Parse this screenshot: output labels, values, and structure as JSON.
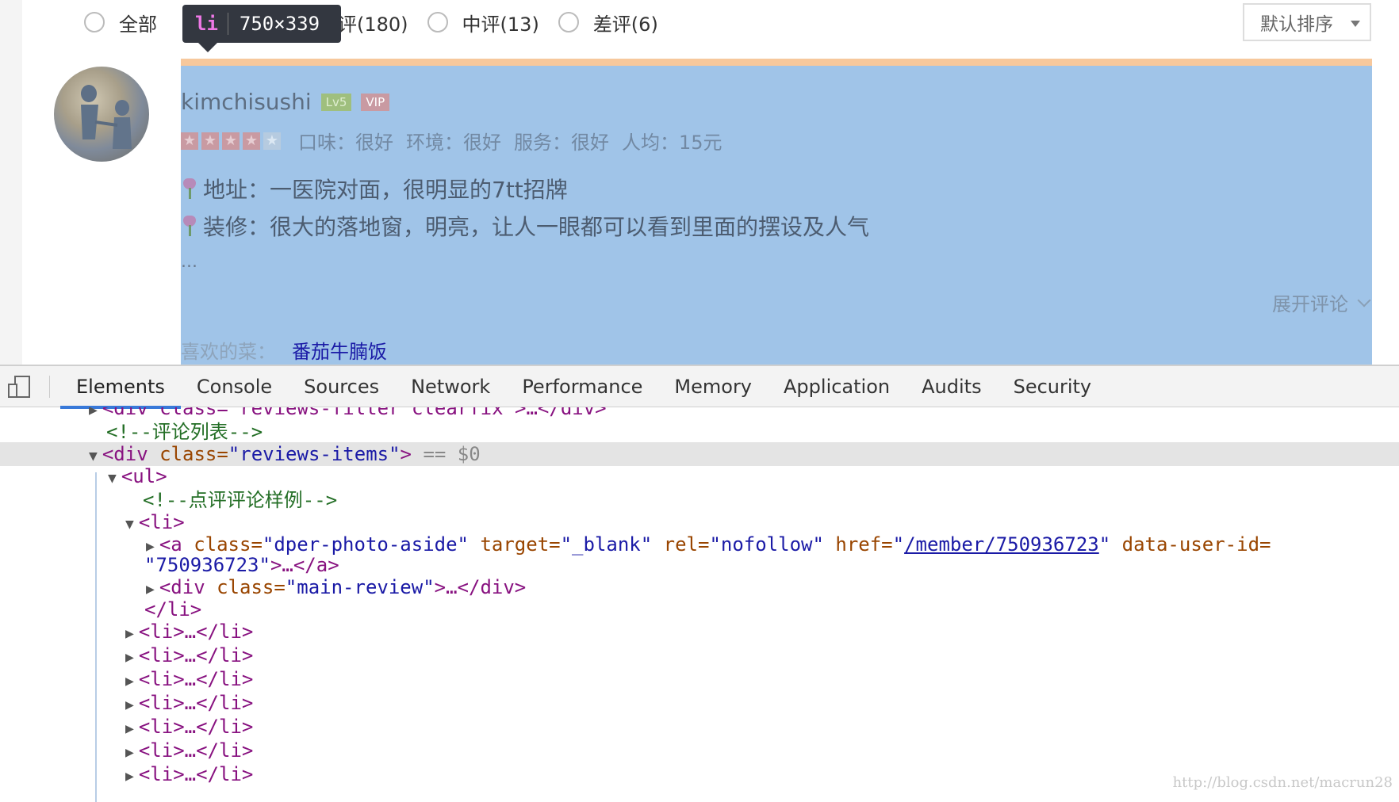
{
  "filters": {
    "all": "全部",
    "good": "好评(180)",
    "mid": "中评(13)",
    "bad": "差评(6)",
    "sort": "默认排序"
  },
  "tooltip": {
    "tag": "li",
    "size": "750×339"
  },
  "review": {
    "username": "kimchisushi",
    "level": "Lv5",
    "vip": "VIP",
    "stars": 4,
    "taste": "口味：很好",
    "env": "环境：很好",
    "service": "服务：很好",
    "avg": "人均：15元",
    "line1": "地址：一医院对面，很明显的7tt招牌",
    "line2": "装修：很大的落地窗，明亮，让人一眼都可以看到里面的摆设及人气",
    "ellipsis": "...",
    "expand": "展开评论",
    "dishes_label": "喜欢的菜：",
    "dishes_value": "番茄牛腩饭"
  },
  "devtools": {
    "tabs": [
      "Elements",
      "Console",
      "Sources",
      "Network",
      "Performance",
      "Memory",
      "Application",
      "Audits",
      "Security"
    ],
    "active_tab": "Elements"
  },
  "dom": {
    "filter_div": "<div class=\"reviews-filter clearfix\">…</div>",
    "comment1": "<!--评论列表-->",
    "items_open": "<div",
    "items_attr": " class=",
    "items_val": "\"reviews-items\"",
    "items_close": ">",
    "items_eq": " == $0",
    "ul": "<ul>",
    "comment2": "<!--点评评论样例-->",
    "li": "<li>",
    "a_tag": "<a",
    "a_class_attr": " class=",
    "a_class_val": "\"dper-photo-aside\"",
    "a_target_attr": " target=",
    "a_target_val": "\"_blank\"",
    "a_rel_attr": " rel=",
    "a_rel_val": "\"nofollow\"",
    "a_href_attr": " href=",
    "a_href_q1": "\"",
    "a_href_link": "/member/750936723",
    "a_href_q2": "\"",
    "a_uid_attr": " data-user-id=",
    "a_uid_val": "\"750936723\"",
    "a_end": ">…</a>",
    "div_tag": "<div",
    "div_class_attr": " class=",
    "div_class_val": "\"main-review\"",
    "div_end": ">…</div>",
    "li_close": "</li>",
    "li_collapsed": "<li>…</li>"
  },
  "watermark": "http://blog.csdn.net/macrun28"
}
